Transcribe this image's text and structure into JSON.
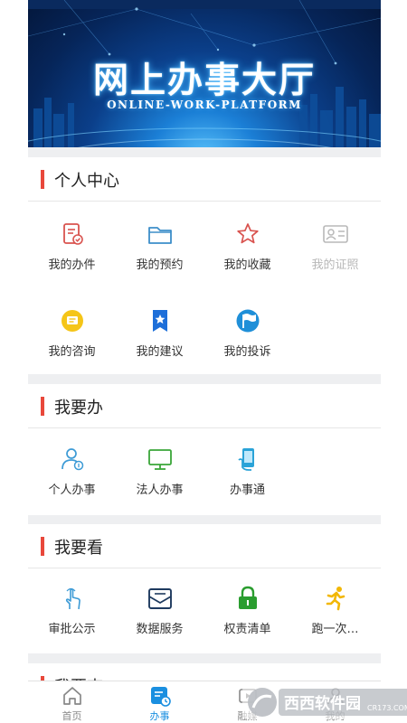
{
  "banner": {
    "title": "网上办事大厅",
    "subtitle": "ONLINE-WORK-PLATFORM"
  },
  "sections": {
    "personal": {
      "title": "个人中心",
      "items": [
        {
          "label": "我的办件",
          "icon": "document-check-icon"
        },
        {
          "label": "我的预约",
          "icon": "folder-icon"
        },
        {
          "label": "我的收藏",
          "icon": "star-icon"
        },
        {
          "label": "我的证照",
          "icon": "id-card-icon"
        },
        {
          "label": "我的咨询",
          "icon": "chat-bubble-icon"
        },
        {
          "label": "我的建议",
          "icon": "bookmark-star-icon"
        },
        {
          "label": "我的投诉",
          "icon": "flag-icon"
        }
      ]
    },
    "todo": {
      "title": "我要办",
      "items": [
        {
          "label": "个人办事",
          "icon": "person-icon"
        },
        {
          "label": "法人办事",
          "icon": "monitor-icon"
        },
        {
          "label": "办事通",
          "icon": "phone-hand-icon"
        }
      ]
    },
    "view": {
      "title": "我要看",
      "items": [
        {
          "label": "审批公示",
          "icon": "touch-hand-icon"
        },
        {
          "label": "数据服务",
          "icon": "mail-box-icon"
        },
        {
          "label": "权责清单",
          "icon": "lock-icon"
        },
        {
          "label": "跑一次…",
          "icon": "running-person-icon"
        }
      ]
    },
    "next": {
      "title": "我要查"
    }
  },
  "tabbar": {
    "items": [
      {
        "label": "首页",
        "icon": "home-icon",
        "active": false
      },
      {
        "label": "办事",
        "icon": "task-icon",
        "active": true
      },
      {
        "label": "融媒",
        "icon": "media-icon",
        "active": false
      },
      {
        "label": "我的",
        "icon": "user-icon",
        "active": false
      }
    ]
  },
  "watermark": {
    "brand": "西西软件园",
    "site": "CR173.COM"
  },
  "colors": {
    "accent": "#e8483b",
    "tab_active": "#1a8fe0",
    "banner_dark": "#062559"
  }
}
